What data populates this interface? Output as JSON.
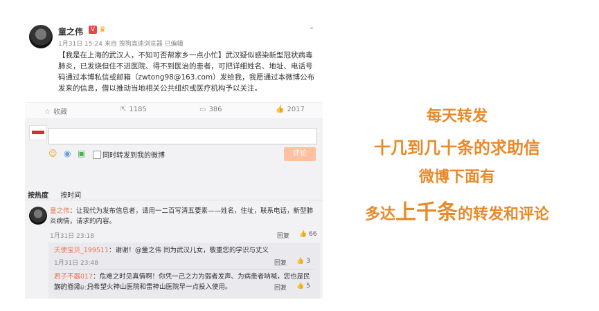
{
  "post": {
    "user_name": "童之伟",
    "verified_badge": "V",
    "vip_icon": "vip-crown-icon",
    "time_source": "1月31日 15:24 来自 搜狗高速浏览器  已编辑",
    "body": "【我是在上海的武汉人，不知可否帮家乡一点小忙】武汉疑似感染新型冠状病毒肺炎，已发烧但住不进医院、得不到医治的患者，可把详细姓名、地址、电话号码通过本博私信或邮箱（zwtong98@163.com）发给我，我愿通过本微博公布发来的信息，借以推动当地相关公共组织或医疗机构予以关注。",
    "actions": {
      "favorite": "收藏",
      "repost": "1185",
      "comments": "386",
      "likes": "2017"
    }
  },
  "composer": {
    "checkbox_label": "同时转发到我的微博",
    "submit_label": "评论"
  },
  "sort_tabs": [
    "按热度",
    "按时间"
  ],
  "comment": {
    "user": "童之伟",
    "text": "：让我代为发布信息者，请用一二百写清五要素——姓名，住址，联系电话，新型肺炎病情，请求的内容。",
    "time": "1月31日 23:18",
    "reply_label": "回复",
    "likes": "66"
  },
  "replies": [
    {
      "user": "天使宝贝_199511",
      "text": "：谢谢！@童之伟 同为武汉儿女，敬重您的学识与丈义",
      "time": "1月31日 23:48",
      "reply_label": "回复",
      "likes": "3"
    },
    {
      "user": "君子不器017",
      "text": "：危难之时见真情啊！你凭一己之力为弱者发声、为病患者呐喊，您也是民族的脊梁。只希望火神山医院和雷神山医院早一点投入使用。",
      "time": "2月1日 00:22",
      "reply_label": "回复",
      "likes": "5"
    }
  ],
  "caption": {
    "line1": "每天转发",
    "line2": "十几到几十条的求助信",
    "line3": "微博下面有",
    "line4_pre": "多达",
    "line4_em": "上千条",
    "line4_post": "的转发和评论"
  }
}
